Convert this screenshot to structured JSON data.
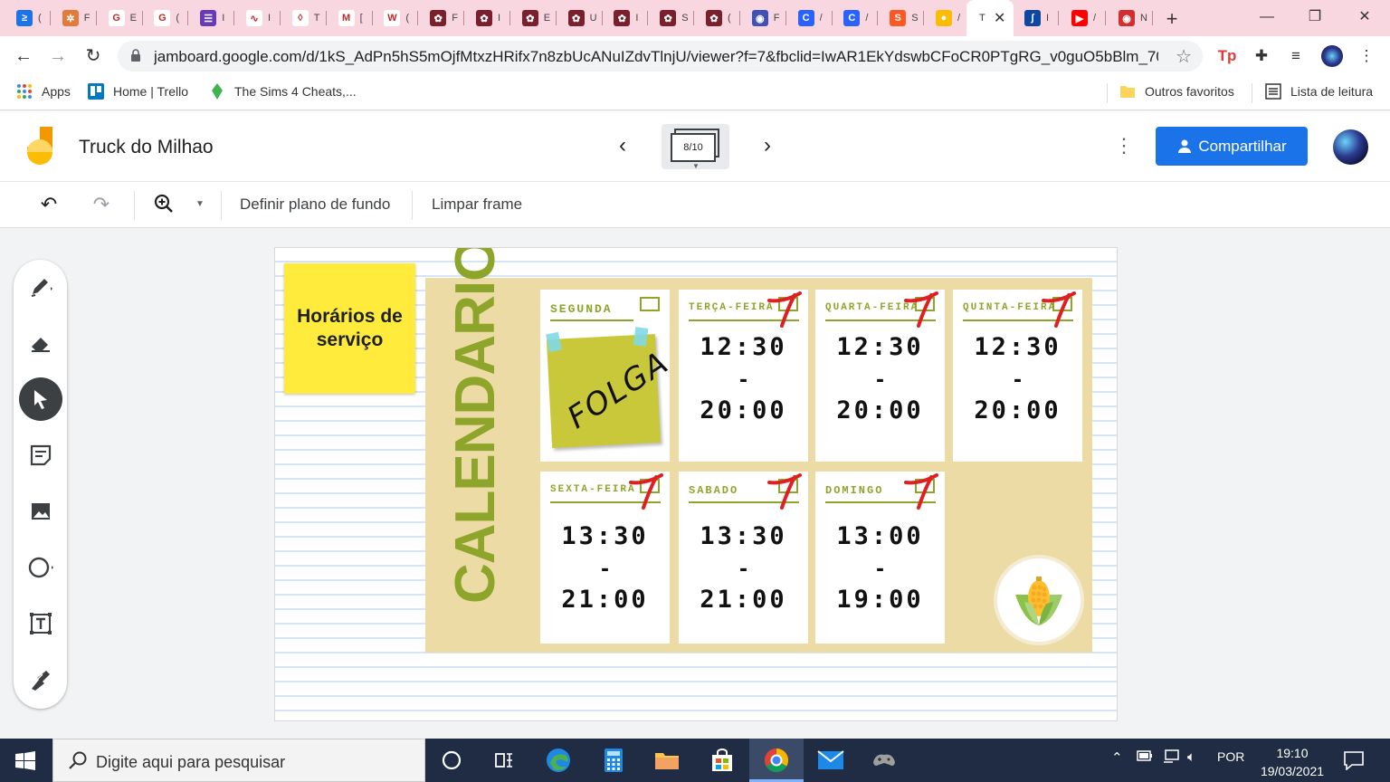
{
  "browser": {
    "tabs": [
      {
        "title": "(",
        "fav_color": "#1a73e8",
        "fav_glyph": "≥"
      },
      {
        "title": "F",
        "fav_color": "#e07b39",
        "fav_glyph": "✲"
      },
      {
        "title": "E",
        "fav_color": "#ffffff",
        "fav_glyph": "G"
      },
      {
        "title": "(",
        "fav_color": "#ffffff",
        "fav_glyph": "G"
      },
      {
        "title": "I",
        "fav_color": "#673ab7",
        "fav_glyph": "☰"
      },
      {
        "title": "I",
        "fav_color": "#ffffff",
        "fav_glyph": "∿"
      },
      {
        "title": "T",
        "fav_color": "#ffffff",
        "fav_glyph": "◊"
      },
      {
        "title": "[",
        "fav_color": "#ffffff",
        "fav_glyph": "M"
      },
      {
        "title": "(",
        "fav_color": "#ffffff",
        "fav_glyph": "W"
      },
      {
        "title": "F",
        "fav_color": "#7a1f2b",
        "fav_glyph": "✿"
      },
      {
        "title": "I",
        "fav_color": "#7a1f2b",
        "fav_glyph": "✿"
      },
      {
        "title": "E",
        "fav_color": "#7a1f2b",
        "fav_glyph": "✿"
      },
      {
        "title": "U",
        "fav_color": "#7a1f2b",
        "fav_glyph": "✿"
      },
      {
        "title": "I",
        "fav_color": "#7a1f2b",
        "fav_glyph": "✿"
      },
      {
        "title": "S",
        "fav_color": "#7a1f2b",
        "fav_glyph": "✿"
      },
      {
        "title": "(",
        "fav_color": "#7a1f2b",
        "fav_glyph": "✿"
      },
      {
        "title": "F",
        "fav_color": "#3f51b5",
        "fav_glyph": "◉"
      },
      {
        "title": "/",
        "fav_color": "#2962ff",
        "fav_glyph": "C"
      },
      {
        "title": "/",
        "fav_color": "#2962ff",
        "fav_glyph": "C"
      },
      {
        "title": "S",
        "fav_color": "#ff5722",
        "fav_glyph": "S"
      },
      {
        "title": "/",
        "fav_color": "#fbbc04",
        "fav_glyph": "●"
      }
    ],
    "active_tab": {
      "title": "T",
      "fav_glyph": "T"
    },
    "tabs_after": [
      {
        "title": "I",
        "fav_color": "#0d47a1",
        "fav_glyph": "ʃ"
      },
      {
        "title": "/",
        "fav_color": "#ff0000",
        "fav_glyph": "▶"
      },
      {
        "title": "N",
        "fav_color": "#d32f2f",
        "fav_glyph": "◉"
      }
    ],
    "url": "jamboard.google.com/d/1kS_AdPn5hS5mOjfMtxzHRifx7n8zbUcANuIZdvTlnjU/viewer?f=7&fbclid=IwAR1EkYdswbCFoCR0PTgRG_v0guO5bBlm_70RN...",
    "bookmarks": {
      "apps": "Apps",
      "trello": "Home | Trello",
      "sims": "The Sims 4 Cheats,...",
      "outros": "Outros favoritos",
      "leitura": "Lista de leitura"
    }
  },
  "jamboard": {
    "title": "Truck do Milhao",
    "frame_counter": "8/10",
    "share_label": "Compartilhar",
    "toolbar": {
      "background_label": "Definir plano de fundo",
      "clear_label": "Limpar frame"
    },
    "sticky_note": "Horários de serviço",
    "poster": {
      "title": "CALENDARIO",
      "cards": [
        {
          "day": "SEGUNDA",
          "folga": "FOLGA",
          "crossed": false
        },
        {
          "day": "TERÇA-FEIRA",
          "start": "12:30",
          "sep": "-",
          "end": "20:00",
          "crossed": true
        },
        {
          "day": "QUARTA-FEIRA",
          "start": "12:30",
          "sep": "-",
          "end": "20:00",
          "crossed": true
        },
        {
          "day": "QUINTA-FEIRA",
          "start": "12:30",
          "sep": "-",
          "end": "20:00",
          "crossed": true
        },
        {
          "day": "SEXTA-FEIRA",
          "start": "13:30",
          "sep": "-",
          "end": "21:00",
          "crossed": true
        },
        {
          "day": "SABADO",
          "start": "13:30",
          "sep": "-",
          "end": "21:00",
          "crossed": true
        },
        {
          "day": "DOMINGO",
          "start": "13:00",
          "sep": "-",
          "end": "19:00",
          "crossed": true
        }
      ]
    }
  },
  "taskbar": {
    "search_placeholder": "Digite aqui para pesquisar",
    "language": "POR",
    "time": "19:10",
    "date": "19/03/2021"
  },
  "colors": {
    "accent": "#1a73e8",
    "poster_bg": "#ecdba4",
    "poster_green": "#8ea52b",
    "cross_red": "#e02020",
    "sticky_yellow": "#ffeb3b"
  }
}
